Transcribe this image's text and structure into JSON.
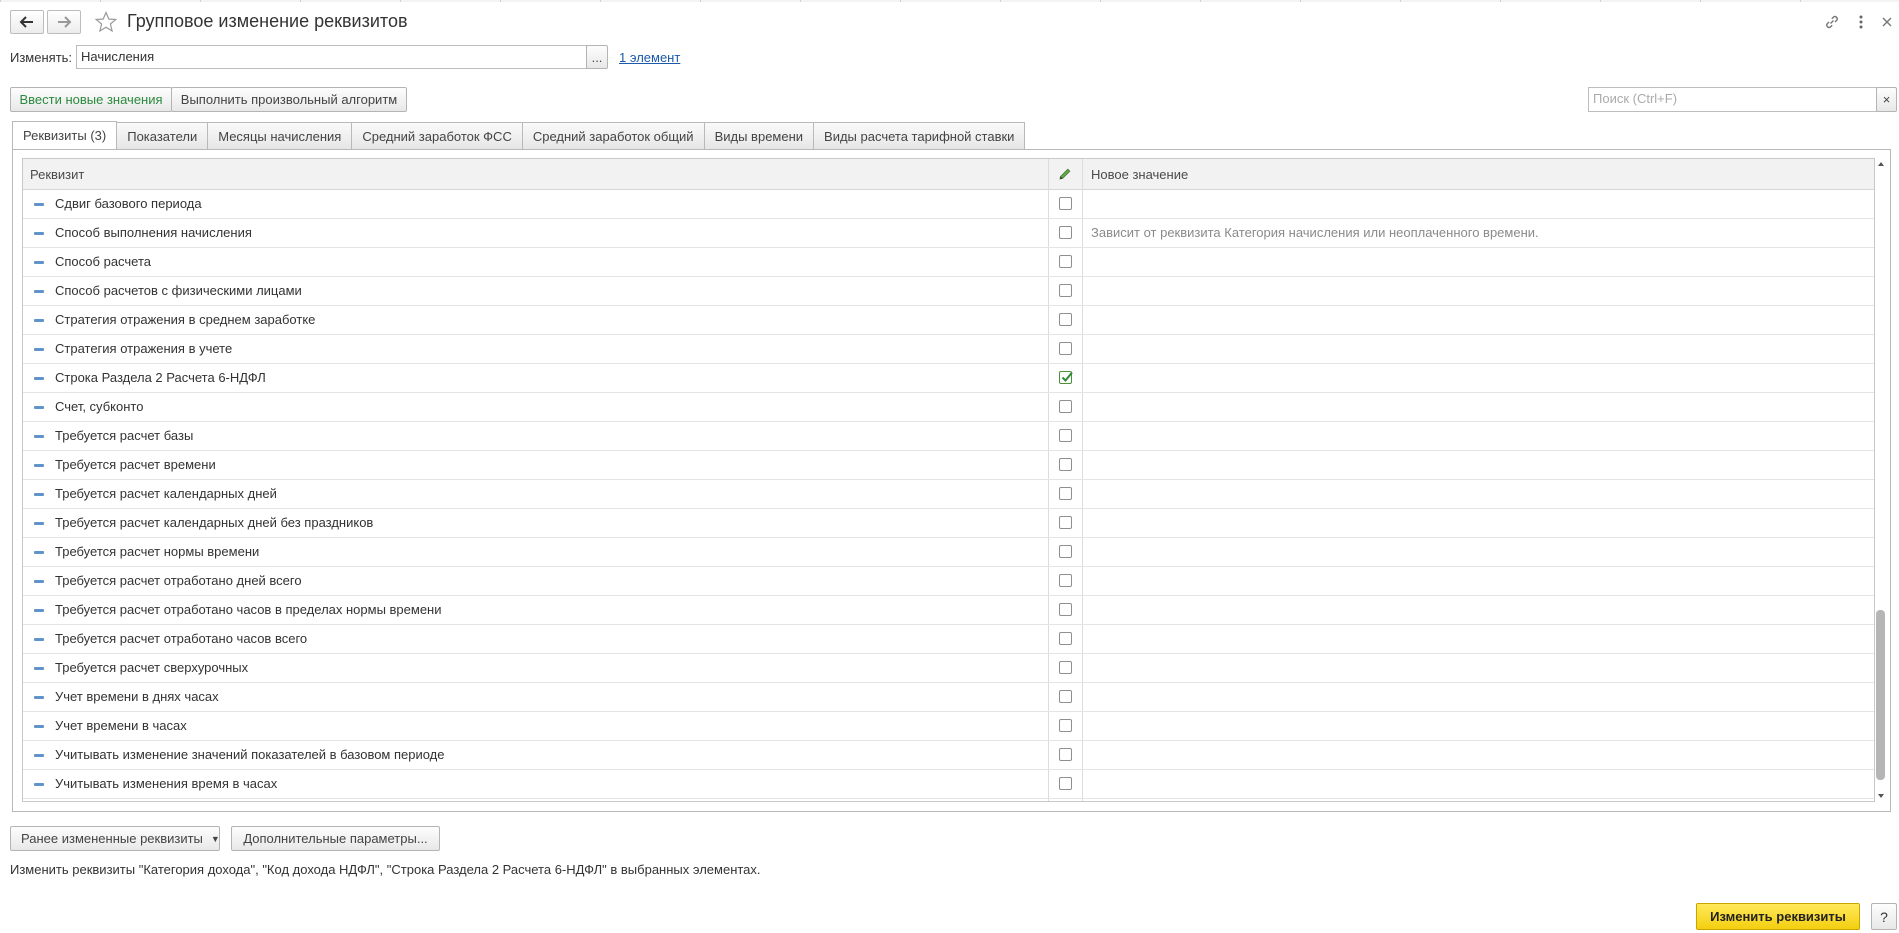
{
  "window": {
    "title": "Групповое изменение реквизитов",
    "back_icon": "arrow-left-icon",
    "forward_icon": "arrow-right-icon",
    "favorite_icon": "star-icon",
    "link_icon": "link-icon",
    "more_icon": "more-vertical-icon",
    "close_icon": "close-icon"
  },
  "change": {
    "label": "Изменять:",
    "value": "Начисления",
    "choose_button": "...",
    "elements_link": "1 элемент"
  },
  "toolbar": {
    "new_values_button": "Ввести новые значения",
    "algorithm_button": "Выполнить произвольный алгоритм",
    "search_placeholder": "Поиск (Ctrl+F)",
    "search_clear": "×"
  },
  "tabs": [
    {
      "label": "Реквизиты (3)",
      "active": true
    },
    {
      "label": "Показатели"
    },
    {
      "label": "Месяцы начисления"
    },
    {
      "label": "Средний заработок ФСС"
    },
    {
      "label": "Средний заработок общий"
    },
    {
      "label": "Виды времени"
    },
    {
      "label": "Виды расчета тарифной ставки"
    }
  ],
  "grid": {
    "columns": {
      "attribute": "Реквизит",
      "edit_icon": "pencil-icon",
      "new_value": "Новое значение"
    },
    "rows": [
      {
        "name": "Сдвиг базового периода",
        "checked": false,
        "value": ""
      },
      {
        "name": "Способ выполнения начисления",
        "checked": false,
        "value": "Зависит от реквизита Категория начисления или неоплаченного времени."
      },
      {
        "name": "Способ расчета",
        "checked": false,
        "value": ""
      },
      {
        "name": "Способ расчетов с физическими лицами",
        "checked": false,
        "value": ""
      },
      {
        "name": "Стратегия отражения в среднем заработке",
        "checked": false,
        "value": ""
      },
      {
        "name": "Стратегия отражения в учете",
        "checked": false,
        "value": ""
      },
      {
        "name": "Строка Раздела 2 Расчета 6-НДФЛ",
        "checked": true,
        "value": ""
      },
      {
        "name": "Счет, субконто",
        "checked": false,
        "value": ""
      },
      {
        "name": "Требуется расчет базы",
        "checked": false,
        "value": ""
      },
      {
        "name": "Требуется расчет времени",
        "checked": false,
        "value": ""
      },
      {
        "name": "Требуется расчет календарных дней",
        "checked": false,
        "value": ""
      },
      {
        "name": "Требуется расчет календарных дней без праздников",
        "checked": false,
        "value": ""
      },
      {
        "name": "Требуется расчет нормы времени",
        "checked": false,
        "value": ""
      },
      {
        "name": "Требуется расчет отработано дней всего",
        "checked": false,
        "value": ""
      },
      {
        "name": "Требуется расчет отработано часов в пределах нормы времени",
        "checked": false,
        "value": ""
      },
      {
        "name": "Требуется расчет отработано часов всего",
        "checked": false,
        "value": ""
      },
      {
        "name": "Требуется расчет сверхурочных",
        "checked": false,
        "value": ""
      },
      {
        "name": "Учет времени в днях часах",
        "checked": false,
        "value": ""
      },
      {
        "name": "Учет времени в часах",
        "checked": false,
        "value": ""
      },
      {
        "name": "Учитывать изменение значений показателей в базовом периоде",
        "checked": false,
        "value": ""
      },
      {
        "name": "Учитывать изменения время в часах",
        "checked": false,
        "value": ""
      }
    ]
  },
  "bottom": {
    "prev_changed_button": "Ранее измененные реквизиты",
    "additional_params_button": "Дополнительные параметры...",
    "summary": "Изменить реквизиты \"Категория дохода\", \"Код дохода НДФЛ\", \"Строка Раздела 2 Расчета 6-НДФЛ\" в выбранных элементах.",
    "apply_button": "Изменить реквизиты",
    "help_button": "?"
  }
}
